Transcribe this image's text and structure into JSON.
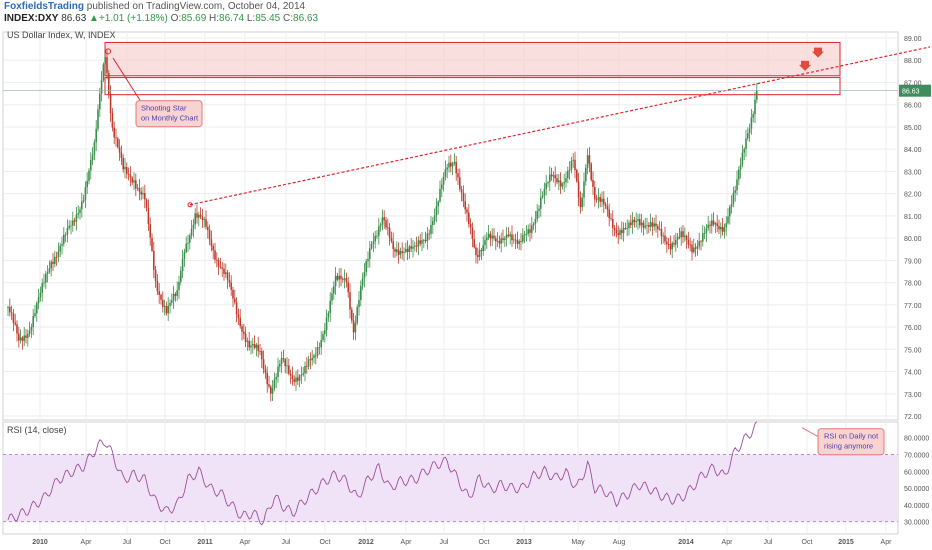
{
  "header": {
    "publisher": "FoxfieldsTrading",
    "published_text": "published on TradingView.com, October 04, 2014",
    "symbol": "INDEX:DXY",
    "last": "86.63",
    "change_arrow": "▲",
    "change": "+1.01 (+1.18%)",
    "open_label": "O:",
    "open": "85.69",
    "high_label": "H:",
    "high": "86.74",
    "low_label": "L:",
    "low": "85.45",
    "close_label": "C:",
    "close": "86.63"
  },
  "colors": {
    "up_candle": "#3a8e4a",
    "down_candle": "#c0392b",
    "resistance": "#e0242a",
    "resistance_fill": "#f6c9c9",
    "rsi_line": "#9c4f9c",
    "rsi_band": "#f1e3f7",
    "grid": "#eeeeee",
    "price_tag": "#3f8d5c"
  },
  "chart_data": [
    {
      "type": "candlestick",
      "title": "US Dollar Index, W, INDEX",
      "ylim": [
        72.0,
        89.0
      ],
      "y_ticks": [
        "89.00",
        "88.00",
        "87.00",
        "86.00",
        "85.00",
        "84.00",
        "83.00",
        "82.00",
        "81.00",
        "80.00",
        "79.00",
        "78.00",
        "77.00",
        "76.00",
        "75.00",
        "74.00",
        "73.00",
        "72.00"
      ],
      "x_tick_labels": [
        "2010",
        "Apr",
        "Jul",
        "Oct",
        "2011",
        "Apr",
        "Jul",
        "Oct",
        "2012",
        "Apr",
        "Jul",
        "Oct",
        "2013",
        "May",
        "Aug",
        "2014",
        "Apr",
        "Jul",
        "Oct",
        "2015",
        "Apr"
      ],
      "last_price_label": "86.63",
      "path_anchors": [
        [
          0,
          76.9
        ],
        [
          6,
          75.3
        ],
        [
          12,
          76.0
        ],
        [
          18,
          77.4
        ],
        [
          24,
          79.0
        ],
        [
          30,
          79.8
        ],
        [
          36,
          80.6
        ],
        [
          42,
          82.0
        ],
        [
          48,
          84.0
        ],
        [
          52,
          87.2
        ],
        [
          54,
          88.4
        ],
        [
          58,
          85.0
        ],
        [
          64,
          83.0
        ],
        [
          70,
          82.7
        ],
        [
          76,
          81.7
        ],
        [
          82,
          78.0
        ],
        [
          88,
          76.8
        ],
        [
          94,
          77.4
        ],
        [
          98,
          79.6
        ],
        [
          104,
          81.0
        ],
        [
          110,
          80.5
        ],
        [
          116,
          79.1
        ],
        [
          122,
          78.0
        ],
        [
          128,
          76.5
        ],
        [
          134,
          75.1
        ],
        [
          140,
          74.8
        ],
        [
          146,
          73.2
        ],
        [
          152,
          74.4
        ],
        [
          158,
          73.8
        ],
        [
          164,
          73.9
        ],
        [
          170,
          74.6
        ],
        [
          176,
          76.1
        ],
        [
          182,
          78.0
        ],
        [
          188,
          78.3
        ],
        [
          192,
          75.8
        ],
        [
          196,
          77.6
        ],
        [
          202,
          79.9
        ],
        [
          208,
          80.9
        ],
        [
          214,
          79.4
        ],
        [
          220,
          79.6
        ],
        [
          226,
          79.4
        ],
        [
          232,
          80.1
        ],
        [
          238,
          81.3
        ],
        [
          244,
          83.2
        ],
        [
          248,
          83.6
        ],
        [
          254,
          81.2
        ],
        [
          260,
          79.2
        ],
        [
          266,
          80.2
        ],
        [
          272,
          79.6
        ],
        [
          278,
          80.4
        ],
        [
          284,
          79.6
        ],
        [
          290,
          80.4
        ],
        [
          296,
          81.8
        ],
        [
          302,
          82.7
        ],
        [
          308,
          82.6
        ],
        [
          314,
          83.4
        ],
        [
          318,
          81.2
        ],
        [
          322,
          84.0
        ],
        [
          326,
          81.8
        ],
        [
          332,
          81.3
        ],
        [
          338,
          80.4
        ],
        [
          344,
          80.3
        ],
        [
          350,
          80.9
        ],
        [
          356,
          80.6
        ],
        [
          362,
          80.2
        ],
        [
          368,
          79.8
        ],
        [
          374,
          80.0
        ],
        [
          380,
          79.6
        ],
        [
          386,
          80.1
        ],
        [
          392,
          80.6
        ],
        [
          398,
          80.6
        ],
        [
          404,
          82.0
        ],
        [
          410,
          84.6
        ],
        [
          414,
          85.8
        ],
        [
          416,
          86.6
        ]
      ],
      "candles_count": 417,
      "resistance_zone": {
        "upper": [
          88.8,
          87.3
        ],
        "lower": [
          87.4,
          86.9
        ]
      },
      "trend_line_points": [
        [
          "2010-12",
          81.5
        ],
        [
          "2014-12",
          88.1
        ]
      ],
      "annotations": [
        "Shooting Star on Monthly Chart"
      ]
    },
    {
      "type": "line",
      "title": "RSI (14, close)",
      "ylim": [
        25.0,
        87.0
      ],
      "y_ticks": [
        "80.0000",
        "70.0000",
        "60.0000",
        "50.0000",
        "40.0000",
        "30.0000"
      ],
      "bands": [
        30,
        70
      ],
      "path_anchors": [
        [
          0,
          31
        ],
        [
          10,
          36
        ],
        [
          20,
          44
        ],
        [
          28,
          55
        ],
        [
          36,
          60
        ],
        [
          42,
          63
        ],
        [
          48,
          72
        ],
        [
          50,
          75
        ],
        [
          54,
          78
        ],
        [
          58,
          70
        ],
        [
          64,
          55
        ],
        [
          70,
          58
        ],
        [
          76,
          55
        ],
        [
          82,
          42
        ],
        [
          88,
          36
        ],
        [
          94,
          40
        ],
        [
          100,
          55
        ],
        [
          106,
          60
        ],
        [
          112,
          50
        ],
        [
          118,
          47
        ],
        [
          124,
          40
        ],
        [
          130,
          33
        ],
        [
          136,
          35
        ],
        [
          142,
          30
        ],
        [
          148,
          45
        ],
        [
          152,
          40
        ],
        [
          158,
          35
        ],
        [
          164,
          42
        ],
        [
          170,
          48
        ],
        [
          176,
          54
        ],
        [
          182,
          58
        ],
        [
          188,
          54
        ],
        [
          194,
          44
        ],
        [
          200,
          55
        ],
        [
          206,
          62
        ],
        [
          212,
          50
        ],
        [
          218,
          54
        ],
        [
          226,
          55
        ],
        [
          232,
          60
        ],
        [
          238,
          64
        ],
        [
          244,
          66
        ],
        [
          250,
          55
        ],
        [
          256,
          44
        ],
        [
          262,
          56
        ],
        [
          268,
          49
        ],
        [
          274,
          52
        ],
        [
          280,
          50
        ],
        [
          286,
          50
        ],
        [
          292,
          57
        ],
        [
          298,
          60
        ],
        [
          304,
          56
        ],
        [
          310,
          59
        ],
        [
          316,
          50
        ],
        [
          322,
          64
        ],
        [
          326,
          50
        ],
        [
          332,
          48
        ],
        [
          338,
          42
        ],
        [
          344,
          46
        ],
        [
          350,
          52
        ],
        [
          356,
          50
        ],
        [
          362,
          46
        ],
        [
          368,
          43
        ],
        [
          374,
          44
        ],
        [
          380,
          50
        ],
        [
          386,
          58
        ],
        [
          392,
          62
        ],
        [
          398,
          57
        ],
        [
          404,
          72
        ],
        [
          410,
          80
        ],
        [
          416,
          87
        ]
      ],
      "annotations": [
        "RSI on Daily not rising anymore"
      ]
    }
  ]
}
